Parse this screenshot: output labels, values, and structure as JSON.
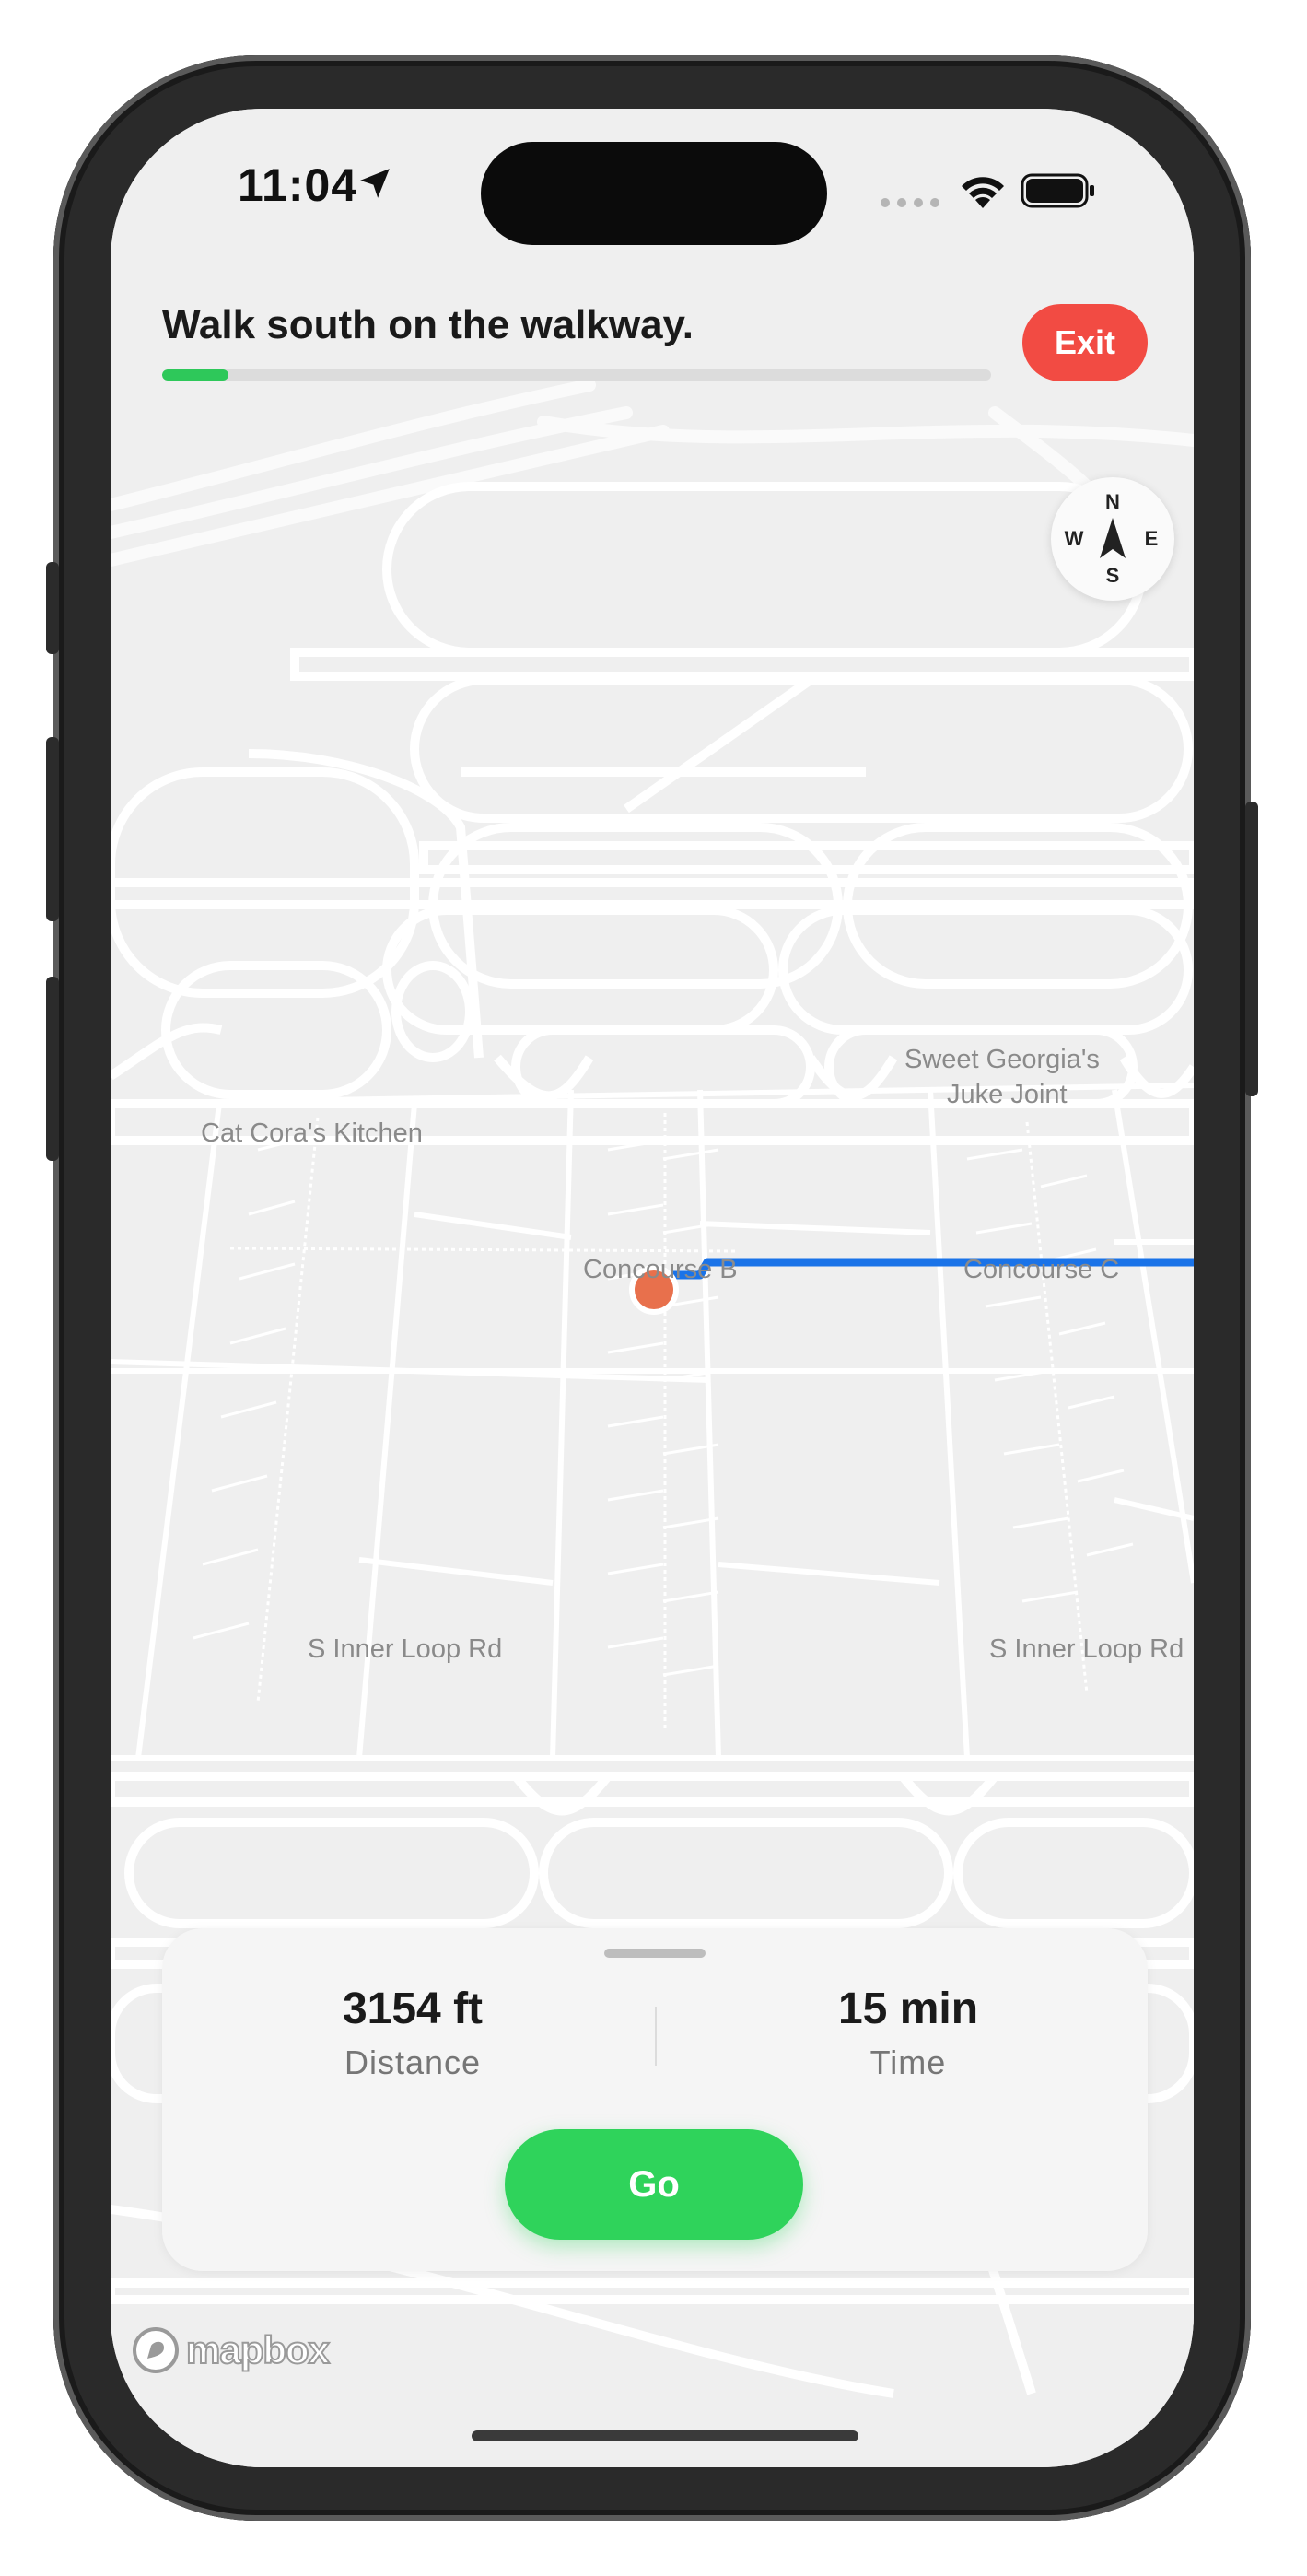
{
  "status_bar": {
    "time": "11:04",
    "location_icon": "location-arrow-icon",
    "signal_icon": "cellular-dots-icon",
    "wifi_icon": "wifi-icon",
    "battery_icon": "battery-full-icon"
  },
  "navigation": {
    "instruction": "Walk south on the walkway.",
    "progress_fraction": 0.08,
    "progress_color": "#2ec85a",
    "exit_label": "Exit",
    "exit_color": "#f24b43"
  },
  "compass": {
    "north": "N",
    "south": "S",
    "east": "E",
    "west": "W"
  },
  "map": {
    "labels": {
      "sweet_georgias": "Sweet Georgia's",
      "juke_joint": "Juke Joint",
      "cat_coras": "Cat Cora's Kitchen",
      "concourse_b": "Concourse B",
      "concourse_c": "Concourse C",
      "inner_loop_left": "S Inner Loop Rd",
      "inner_loop_right": "S Inner Loop Rd"
    },
    "route_color": "#1a73e8",
    "current_location_color": "#e8704c"
  },
  "summary": {
    "distance_value": "3154 ft",
    "distance_label": "Distance",
    "time_value": "15 min",
    "time_label": "Time",
    "go_label": "Go",
    "go_color": "#2fd35b"
  },
  "attribution": {
    "logo_icon": "mapbox-logo-icon",
    "text": "mapbox"
  }
}
